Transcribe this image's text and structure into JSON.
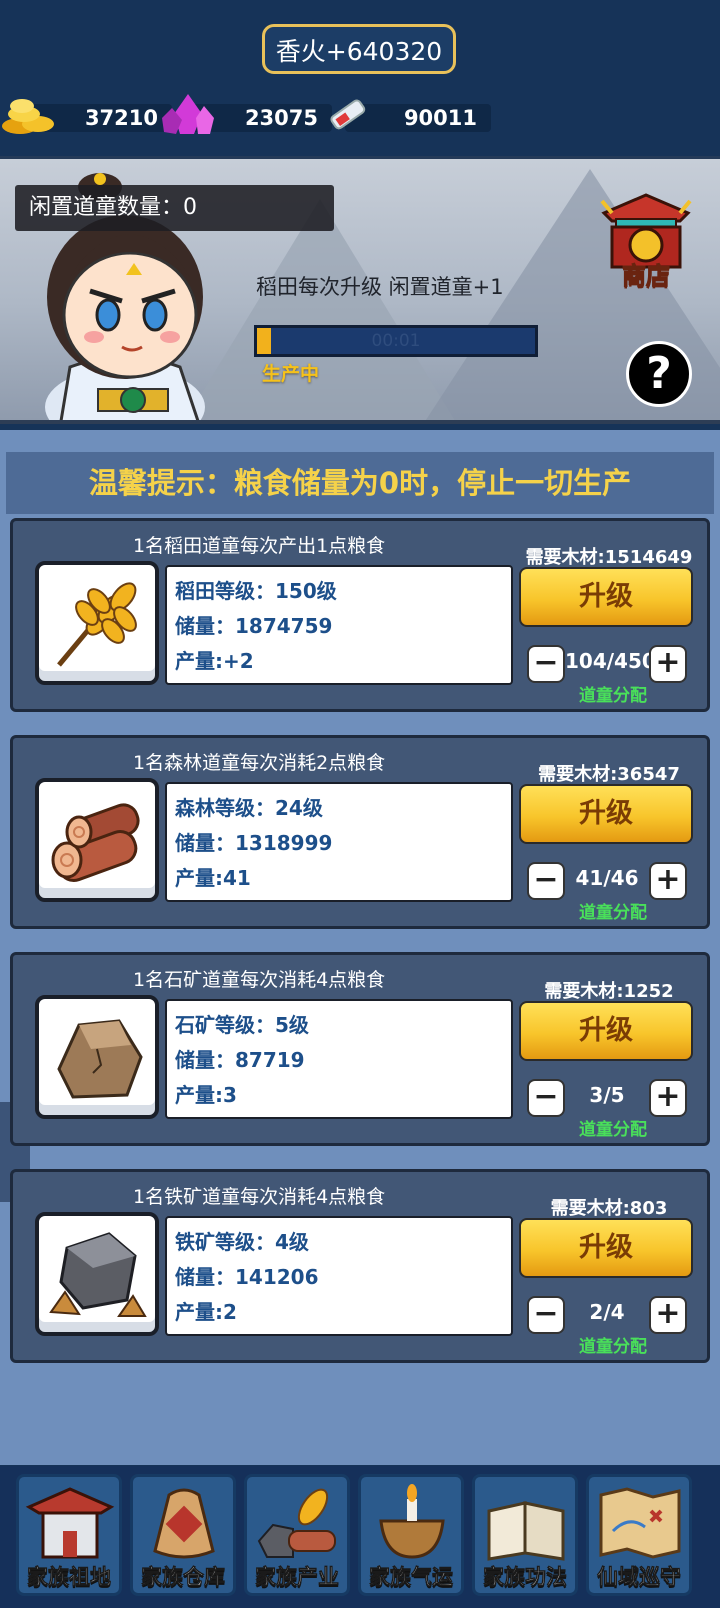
{
  "top": {
    "incense": "香火+640320",
    "resources": [
      {
        "icon": "gold-coins-icon",
        "value": "37210"
      },
      {
        "icon": "purple-crystal-icon",
        "value": "23075"
      },
      {
        "icon": "scroll-icon",
        "value": "90011"
      }
    ]
  },
  "scene": {
    "idle_text": "闲置道童数量：0",
    "production_text": "稻田每次升级 闲置道童+1",
    "timer": "00:01",
    "progress": 0.05,
    "status": "生产中",
    "shop_label": "商店",
    "help_label": "?"
  },
  "tip": "温馨提示：粮食储量为0时，停止一切生产",
  "cards": [
    {
      "title": "1名稻田道童每次产出1点粮食",
      "icon": "wheat-icon",
      "level": "稻田等级：150级",
      "storage": "储量：1874759",
      "output": "产量:+2",
      "need": "需要木材:1514649",
      "upgrade": "升级",
      "minus": "−",
      "plus": "+",
      "count": "104/450",
      "alloc": "道童分配"
    },
    {
      "title": "1名森林道童每次消耗2点粮食",
      "icon": "logs-icon",
      "level": "森林等级：24级",
      "storage": "储量：1318999",
      "output": "产量:41",
      "need": "需要木材:36547",
      "upgrade": "升级",
      "minus": "−",
      "plus": "+",
      "count": "41/46",
      "alloc": "道童分配"
    },
    {
      "title": "1名石矿道童每次消耗4点粮食",
      "icon": "stone-icon",
      "level": "石矿等级：5级",
      "storage": "储量：87719",
      "output": "产量:3",
      "need": "需要木材:1252",
      "upgrade": "升级",
      "minus": "−",
      "plus": "+",
      "count": "3/5",
      "alloc": "道童分配"
    },
    {
      "title": "1名铁矿道童每次消耗4点粮食",
      "icon": "iron-ore-icon",
      "level": "铁矿等级：4级",
      "storage": "储量：141206",
      "output": "产量:2",
      "need": "需要木材:803",
      "upgrade": "升级",
      "minus": "−",
      "plus": "+",
      "count": "2/4",
      "alloc": "道童分配"
    }
  ],
  "nav": [
    {
      "label": "家族祖地",
      "icon": "ancestral-hall-icon"
    },
    {
      "label": "家族仓库",
      "icon": "warehouse-sack-icon"
    },
    {
      "label": "家族产业",
      "icon": "industry-icon"
    },
    {
      "label": "家族气运",
      "icon": "incense-burner-icon"
    },
    {
      "label": "家族功法",
      "icon": "book-icon"
    },
    {
      "label": "仙域巡守",
      "icon": "map-icon"
    }
  ]
}
